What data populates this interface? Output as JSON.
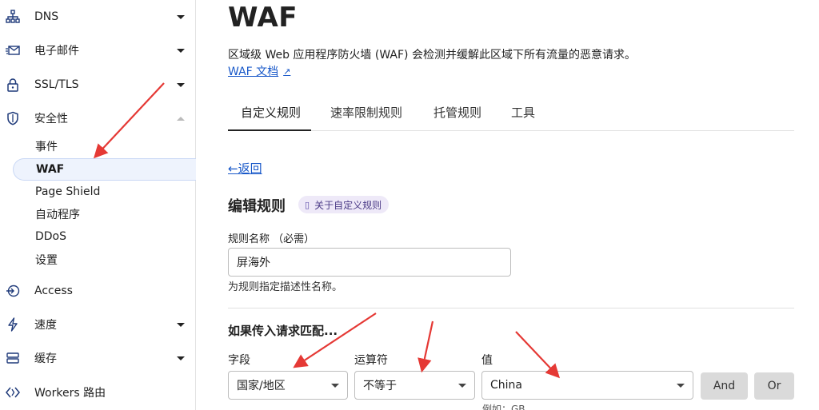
{
  "sidebar": {
    "items": [
      {
        "label": "DNS",
        "icon": "network-icon"
      },
      {
        "label": "电子邮件",
        "icon": "email-icon"
      },
      {
        "label": "SSL/TLS",
        "icon": "lock-icon"
      },
      {
        "label": "安全性",
        "icon": "shield-icon"
      },
      {
        "label": "Access",
        "icon": "access-icon"
      },
      {
        "label": "速度",
        "icon": "bolt-icon"
      },
      {
        "label": "缓存",
        "icon": "cache-icon"
      },
      {
        "label": "Workers 路由",
        "icon": "workers-icon"
      }
    ],
    "security_sub": [
      "事件",
      "WAF",
      "Page Shield",
      "自动程序",
      "DDoS",
      "设置"
    ]
  },
  "header": {
    "title": "WAF",
    "description": "区域级 Web 应用程序防火墙 (WAF) 会检测并缓解此区域下所有流量的恶意请求。",
    "doc_link": "WAF 文档"
  },
  "tabs": [
    "自定义规则",
    "速率限制规则",
    "托管规则",
    "工具"
  ],
  "back_label": "←返回",
  "editor": {
    "title": "编辑规则",
    "badge": "关于自定义规则",
    "name_label": "规则名称 （必需）",
    "name_value": "屏海外",
    "name_help": "为规则指定描述性名称。",
    "match_title": "如果传入请求匹配...",
    "field_label": "字段",
    "operator_label": "运算符",
    "value_label": "值",
    "field_value": "国家/地区",
    "operator_value": "不等于",
    "value_value": "China",
    "and_label": "And",
    "or_label": "Or",
    "value_hint": "例如：GB"
  },
  "colors": {
    "link": "#1858c9",
    "arrow": "#e53935",
    "active_bg": "#eef3fd",
    "badge_bg": "#eee9f8"
  }
}
